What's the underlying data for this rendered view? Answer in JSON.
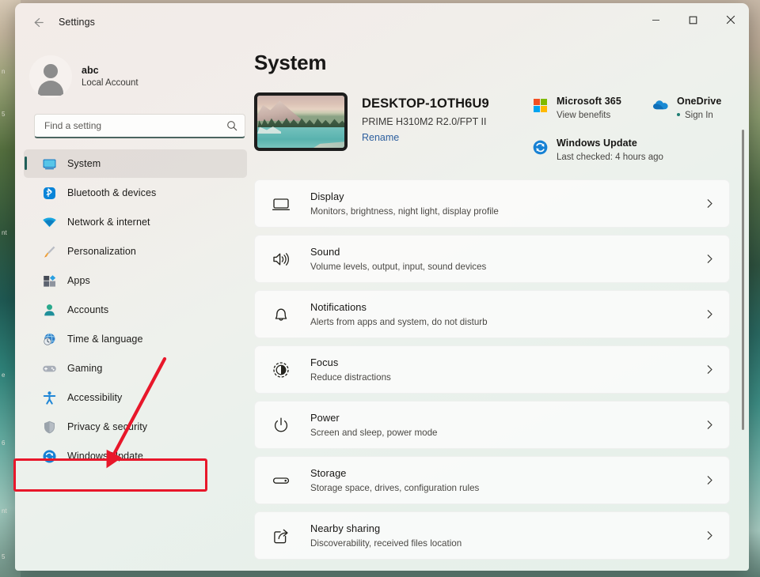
{
  "window": {
    "title": "Settings",
    "back_icon": "back-arrow-icon",
    "controls": {
      "minimize": "minimize-icon",
      "maximize": "maximize-icon",
      "close": "close-icon"
    }
  },
  "account": {
    "name": "abc",
    "type": "Local Account",
    "avatar": "user-avatar-icon"
  },
  "search": {
    "placeholder": "Find a setting",
    "value": "",
    "icon": "search-icon"
  },
  "sidebar": {
    "items": [
      {
        "label": "System",
        "icon": "monitor-icon",
        "selected": true
      },
      {
        "label": "Bluetooth & devices",
        "icon": "bluetooth-icon",
        "selected": false
      },
      {
        "label": "Network & internet",
        "icon": "wifi-icon",
        "selected": false
      },
      {
        "label": "Personalization",
        "icon": "paintbrush-icon",
        "selected": false
      },
      {
        "label": "Apps",
        "icon": "apps-grid-icon",
        "selected": false
      },
      {
        "label": "Accounts",
        "icon": "person-icon",
        "selected": false
      },
      {
        "label": "Time & language",
        "icon": "clock-globe-icon",
        "selected": false
      },
      {
        "label": "Gaming",
        "icon": "gamepad-icon",
        "selected": false
      },
      {
        "label": "Accessibility",
        "icon": "accessibility-person-icon",
        "selected": false
      },
      {
        "label": "Privacy & security",
        "icon": "shield-icon",
        "selected": false
      },
      {
        "label": "Windows Update",
        "icon": "update-refresh-icon",
        "selected": false
      }
    ]
  },
  "main": {
    "page_title": "System",
    "device": {
      "name": "DESKTOP-1OTH6U9",
      "model": "PRIME H310M2 R2.0/FPT II",
      "rename_label": "Rename",
      "thumbnail": "device-wallpaper-thumbnail"
    },
    "quick_links": [
      {
        "title": "Microsoft 365",
        "subtitle": "View benefits",
        "icon": "microsoft-logo-icon",
        "has_dot": false
      },
      {
        "title": "OneDrive",
        "subtitle": "Sign In",
        "icon": "onedrive-cloud-icon",
        "has_dot": true
      },
      {
        "title": "Windows Update",
        "subtitle": "Last checked: 4 hours ago",
        "icon": "update-refresh-icon",
        "has_dot": false
      }
    ],
    "cards": [
      {
        "title": "Display",
        "subtitle": "Monitors, brightness, night light, display profile",
        "icon": "display-monitor-icon"
      },
      {
        "title": "Sound",
        "subtitle": "Volume levels, output, input, sound devices",
        "icon": "speaker-icon"
      },
      {
        "title": "Notifications",
        "subtitle": "Alerts from apps and system, do not disturb",
        "icon": "bell-icon"
      },
      {
        "title": "Focus",
        "subtitle": "Reduce distractions",
        "icon": "focus-circle-icon"
      },
      {
        "title": "Power",
        "subtitle": "Screen and sleep, power mode",
        "icon": "power-icon"
      },
      {
        "title": "Storage",
        "subtitle": "Storage space, drives, configuration rules",
        "icon": "storage-drive-icon"
      },
      {
        "title": "Nearby sharing",
        "subtitle": "Discoverability, received files location",
        "icon": "share-icon"
      }
    ],
    "chevron_icon": "chevron-right-icon"
  },
  "annotation": {
    "color": "#e8172a",
    "highlight_target": "Windows Update",
    "arrow_icon": "pointer-arrow-icon"
  },
  "colors": {
    "accent": "#1f5e58",
    "link": "#2d5f9e",
    "annotation_red": "#e8172a",
    "bluetooth_blue": "#0a84d8",
    "onedrive_blue": "#1a8ad4"
  }
}
